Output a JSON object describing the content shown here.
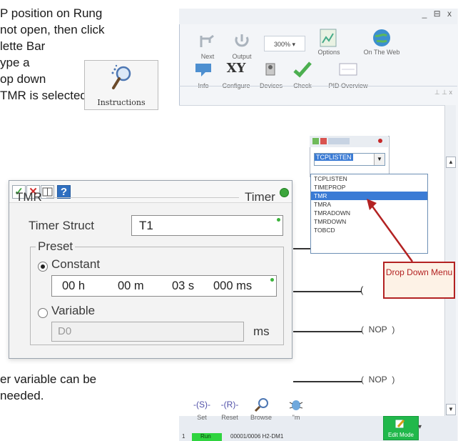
{
  "doc_text": {
    "line1": "P position on Rung",
    "line2": "not open, then click",
    "line3": "lette Bar",
    "line4": "ype a",
    "line5": "op down",
    "line6": "TMR is selected, a",
    "line7": "er variable can be",
    "line8": "needed."
  },
  "instructions_button": {
    "label": "Instructions",
    "icon": "magnifier-icon"
  },
  "window": {
    "controls": "_ ⊟ x",
    "toolbar1": [
      {
        "label": "Next",
        "icon": "next-icon"
      },
      {
        "label": "Output",
        "icon": "output-icon"
      },
      {
        "label": "Options",
        "icon": "options-icon"
      },
      {
        "label": "On The Web",
        "icon": "globe-icon"
      }
    ],
    "zoom": "300% ▾",
    "toolbar2": [
      {
        "label": "Info",
        "icon": "info-icon"
      },
      {
        "label": "Configure",
        "icon": "xy-icon"
      },
      {
        "label": "Devices",
        "icon": "devices-icon"
      },
      {
        "label": "Check",
        "icon": "check-icon"
      },
      {
        "label": "PID Overview",
        "icon": "pid-icon"
      }
    ],
    "pin": "⊥ ⊥ x"
  },
  "mini_dialog": {
    "combo_value": "TCPLISTEN",
    "items": [
      "TCPLISTEN",
      "TIMEPROP",
      "TMR",
      "TMRA",
      "TMRADOWN",
      "TMRDOWN",
      "TOBCD"
    ],
    "selected_index": 2
  },
  "callout": {
    "text": "Drop Down Menu"
  },
  "coils": [
    {
      "label": "NOP"
    },
    {
      "label": "NOP"
    }
  ],
  "bottom_toolbar": [
    {
      "label": "Set",
      "icon": "set-coil-icon"
    },
    {
      "label": "Reset",
      "icon": "reset-coil-icon"
    },
    {
      "label": "Browse",
      "icon": "browse-icon"
    },
    {
      "label": "\"m",
      "icon": "bug-icon"
    },
    {
      "label": "Edit Mode",
      "icon": "edit-mode-icon"
    }
  ],
  "status_bar": {
    "run": "Run",
    "text": "00001/0006 H2-DM1",
    "index": "1"
  },
  "timer_dialog": {
    "buttons": {
      "ok": "✓",
      "cancel": "✕",
      "help": "?"
    },
    "instruction": "TMR",
    "instruction_type": "Timer",
    "timer_struct_label": "Timer Struct",
    "timer_struct_value": "T1",
    "preset_label": "Preset",
    "constant_label": "Constant",
    "constant_value": {
      "hours": "00 h",
      "minutes": "00 m",
      "seconds": "03 s",
      "ms": "000 ms"
    },
    "variable_label": "Variable",
    "variable_value": "D0",
    "variable_unit": "ms"
  },
  "colors": {
    "accent_blue": "#3a7bd5",
    "callout_red": "#b32222",
    "status_green": "#3ba53b",
    "edit_mode_green": "#21b84b"
  }
}
